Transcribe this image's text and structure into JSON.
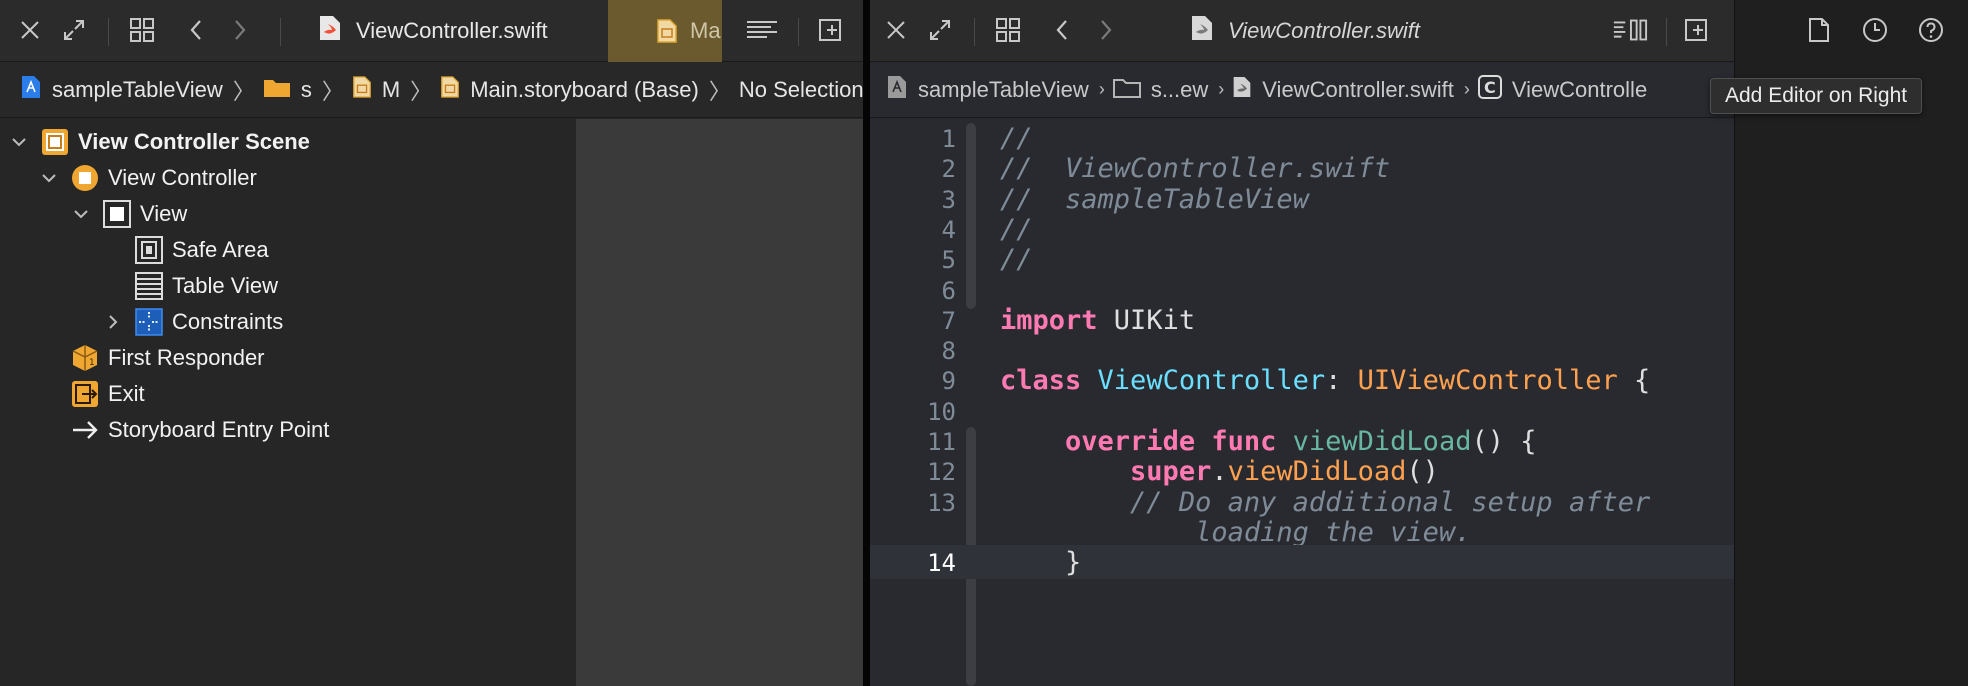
{
  "left_pane": {
    "tabs": [
      {
        "label": "ViewController.swift",
        "icon": "swift-file-icon"
      },
      {
        "label": "Ma",
        "icon": "storyboard-file-icon"
      }
    ],
    "jumpbar": {
      "items": [
        "sampleTableView",
        "s",
        "M",
        "Main.storyboard (Base)",
        "No Selection"
      ]
    },
    "outline": [
      {
        "label": "View Controller Scene",
        "icon": "scene-icon",
        "expanded": true
      },
      {
        "label": "View Controller",
        "icon": "view-controller-icon",
        "expanded": true
      },
      {
        "label": "View",
        "icon": "view-icon",
        "expanded": true
      },
      {
        "label": "Safe Area",
        "icon": "safe-area-icon"
      },
      {
        "label": "Table View",
        "icon": "table-view-icon"
      },
      {
        "label": "Constraints",
        "icon": "constraints-icon",
        "expanded": false
      },
      {
        "label": "First Responder",
        "icon": "first-responder-icon"
      },
      {
        "label": "Exit",
        "icon": "exit-icon"
      },
      {
        "label": "Storyboard Entry Point",
        "icon": "arrow-right-icon"
      }
    ]
  },
  "right_pane": {
    "tab": {
      "label": "ViewController.swift",
      "icon": "swift-file-icon"
    },
    "jumpbar": {
      "items": [
        "sampleTableView",
        "s...ew",
        "ViewController.swift",
        "ViewControlle"
      ]
    },
    "code": {
      "current_line": 14,
      "lines": [
        {
          "n": "1",
          "tokens": [
            [
              "cm",
              "//"
            ]
          ]
        },
        {
          "n": "2",
          "tokens": [
            [
              "cm",
              "//  ViewController.swift"
            ]
          ]
        },
        {
          "n": "3",
          "tokens": [
            [
              "cm",
              "//  sampleTableView"
            ]
          ]
        },
        {
          "n": "4",
          "tokens": [
            [
              "cm",
              "//"
            ]
          ]
        },
        {
          "n": "5",
          "tokens": [
            [
              "cm",
              "//"
            ]
          ]
        },
        {
          "n": "6",
          "tokens": []
        },
        {
          "n": "7",
          "tokens": [
            [
              "kw",
              "import"
            ],
            [
              "pl",
              " UIKit"
            ]
          ]
        },
        {
          "n": "8",
          "tokens": []
        },
        {
          "n": "9",
          "tokens": [
            [
              "kw",
              "class"
            ],
            [
              "pl",
              " "
            ],
            [
              "cls",
              "ViewController"
            ],
            [
              "pl",
              ": "
            ],
            [
              "sup",
              "UIViewController"
            ],
            [
              "pl",
              " {"
            ]
          ]
        },
        {
          "n": "10",
          "tokens": []
        },
        {
          "n": "11",
          "tokens": [
            [
              "pl",
              "    "
            ],
            [
              "kw",
              "override"
            ],
            [
              "pl",
              " "
            ],
            [
              "kw",
              "func"
            ],
            [
              "pl",
              " "
            ],
            [
              "fn",
              "viewDidLoad"
            ],
            [
              "pl",
              "() {"
            ]
          ]
        },
        {
          "n": "12",
          "tokens": [
            [
              "pl",
              "        "
            ],
            [
              "kw",
              "super"
            ],
            [
              "pl",
              "."
            ],
            [
              "meth",
              "viewDidLoad"
            ],
            [
              "pl",
              "()"
            ]
          ]
        },
        {
          "n": "13",
          "tokens": [
            [
              "pl",
              "        "
            ],
            [
              "cm",
              "// Do any additional setup after"
            ]
          ]
        },
        {
          "n": "",
          "tokens": [
            [
              "pl",
              "            "
            ],
            [
              "cm",
              "loading the view."
            ]
          ]
        },
        {
          "n": "14",
          "tokens": [
            [
              "pl",
              "    }"
            ]
          ]
        }
      ]
    }
  },
  "tooltip": "Add Editor on Right",
  "colors": {
    "comment": "#7f8c98",
    "keyword": "#ff7ab2",
    "type_decl": "#6bdfff",
    "supertype": "#ffa14f",
    "function": "#67b7a4",
    "accent_orange": "#f0a732"
  }
}
